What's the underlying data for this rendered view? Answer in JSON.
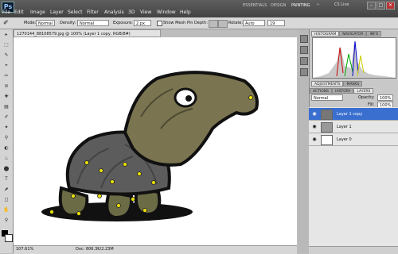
{
  "app": {
    "logo": "Ps",
    "workspaces": [
      "ESSENTIALS",
      "DESIGN",
      "PAINTING"
    ],
    "cs_live": "CS Live"
  },
  "menu": [
    "File",
    "Edit",
    "Image",
    "Layer",
    "Select",
    "Filter",
    "Analysis",
    "3D",
    "View",
    "Window",
    "Help"
  ],
  "window_controls": [
    "–",
    "□",
    "✕"
  ],
  "options": {
    "mode_label": "Mode:",
    "mode_value": "Normal",
    "density_label": "Density:",
    "density_value": "Normal",
    "exposure_label": "Exposure:",
    "exposure_value": "2 px",
    "show_mesh_label": "Show Mesh",
    "pin_depth_label": "Pin Depth:",
    "rotate_label": "Rotate:",
    "rotate_value": "Auto",
    "rotate_num": "19"
  },
  "tools": [
    "▸",
    "⬚",
    "✎",
    "⌖",
    "✂",
    "⊘",
    "✚",
    "▤",
    "✐",
    "✦",
    "⚲",
    "◐",
    "♨",
    "⬤",
    "T",
    "⬈",
    "◻",
    "✋",
    "⚲"
  ],
  "document": {
    "tab_title": "1270144_88108579.jpg @ 100% (Layer 1 copy, RGB/8#)",
    "zoom": "107.61%",
    "doc_info": "Doc: 806.3K/2.23M"
  },
  "panels": {
    "top_tabs": [
      "HISTOGRAM",
      "NAVIGATOR",
      "INFO"
    ],
    "mid_tabs": [
      "ADJUSTMENTS",
      "MASKS"
    ],
    "layer_tabs": [
      "ACTIONS",
      "HISTORY",
      "LAYERS"
    ],
    "blend_mode": "Normal",
    "opacity_label": "Opacity:",
    "opacity_value": "100%",
    "fill_label": "Fill:",
    "fill_value": "100%",
    "layers": [
      {
        "name": "Layer 1 copy",
        "selected": true
      },
      {
        "name": "Layer 1",
        "selected": false
      },
      {
        "name": "Layer 0",
        "selected": false
      }
    ]
  }
}
